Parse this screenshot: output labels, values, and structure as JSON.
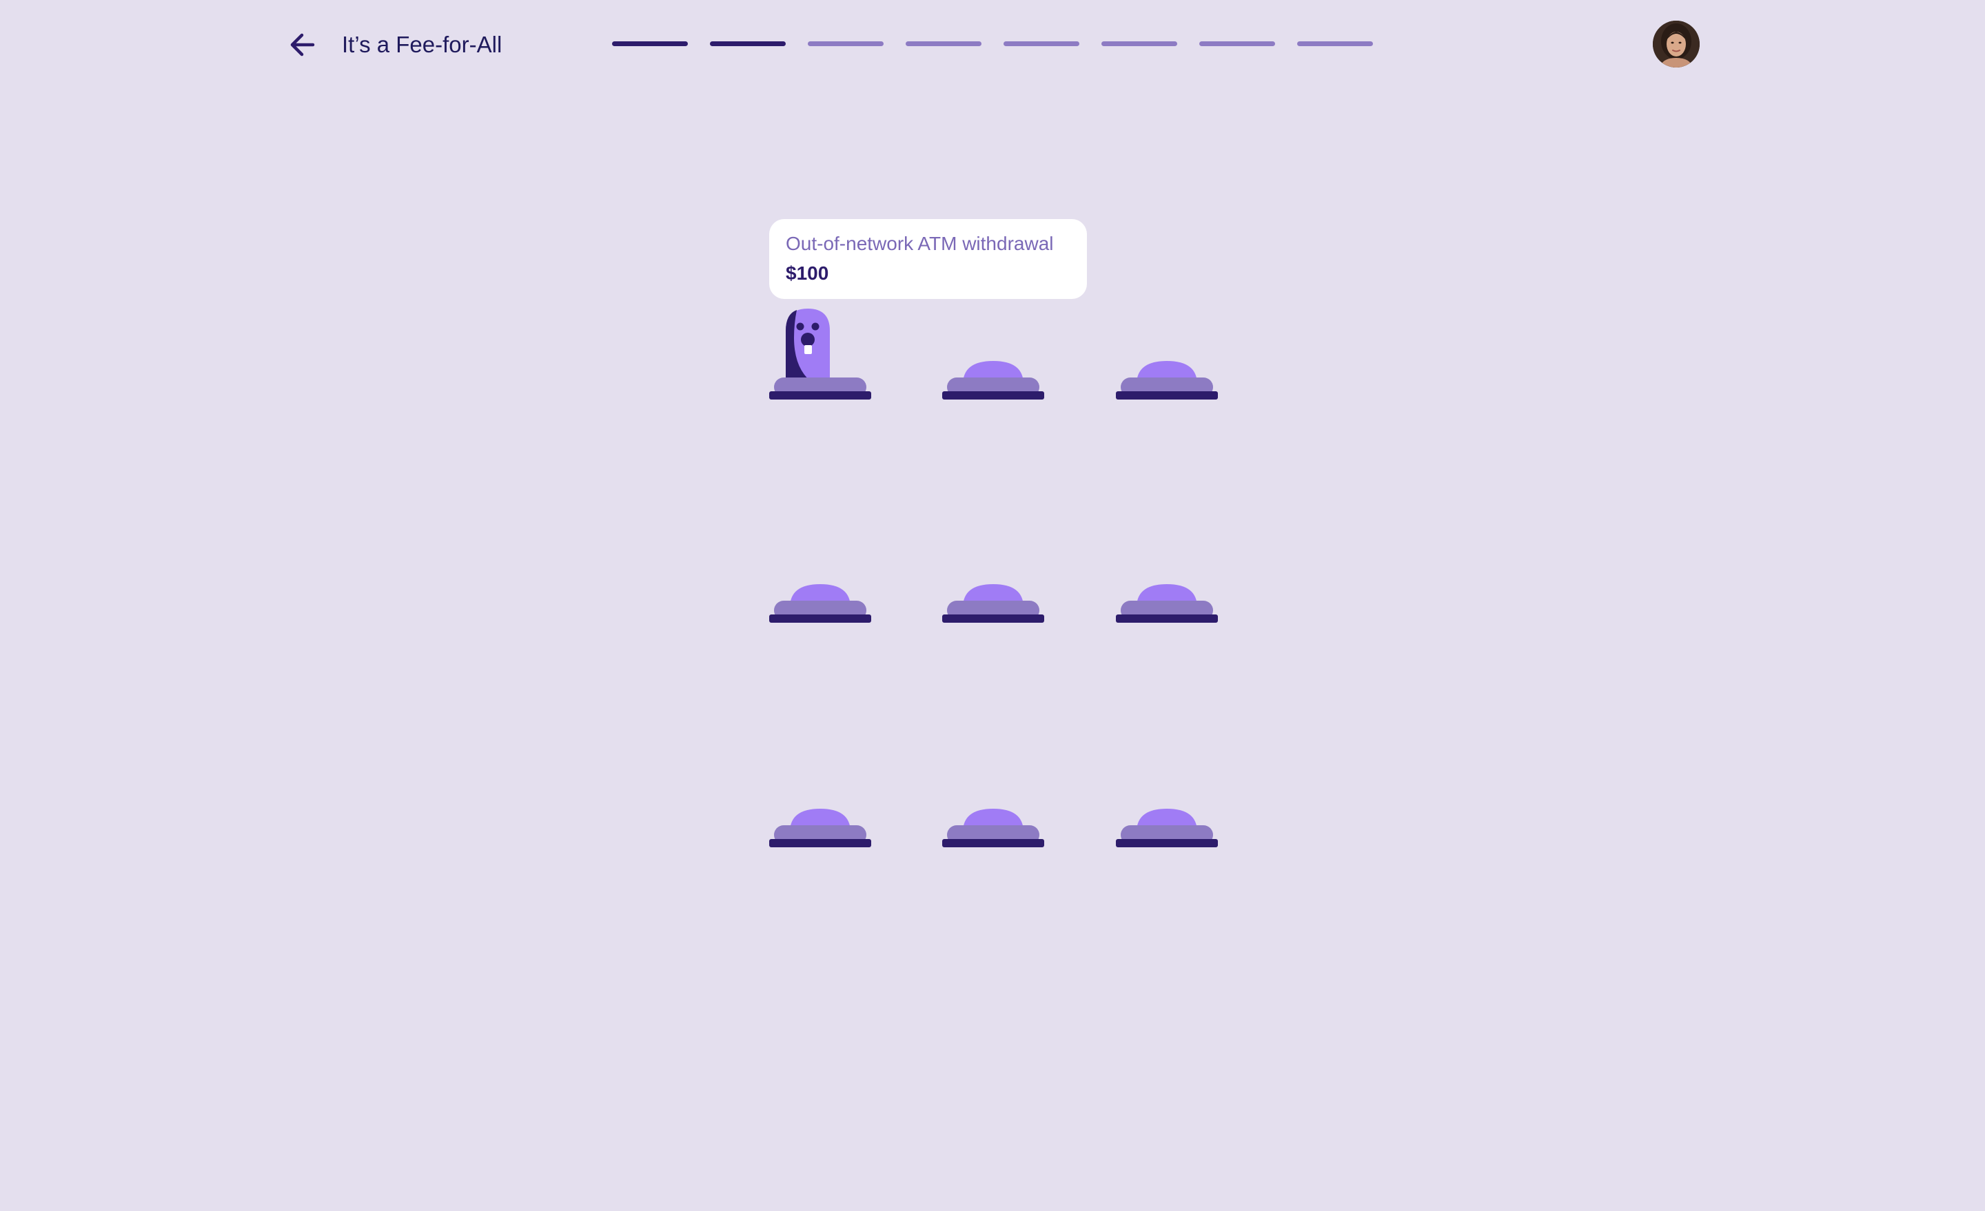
{
  "header": {
    "back_icon": "arrow-left-icon",
    "title": "It’s a Fee-for-All",
    "avatar": "user-avatar",
    "progress": {
      "total_steps": 8,
      "completed_steps": 2
    }
  },
  "game": {
    "grid": {
      "rows": 3,
      "columns": 3
    },
    "active_hole": {
      "row": 1,
      "column": 1
    },
    "popup": {
      "label": "Out-of-network ATM withdrawal",
      "amount": "$100"
    }
  },
  "colors": {
    "background": "#e4dfee",
    "dark_purple": "#2d1c6b",
    "mole_purple": "#a07cf5",
    "mound_purple": "#8d7bc3",
    "light_progress": "#8d7bc3"
  }
}
